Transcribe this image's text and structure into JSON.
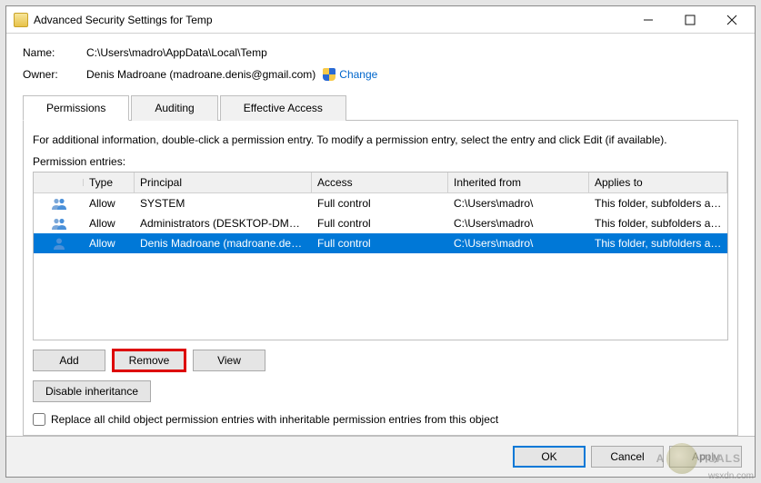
{
  "window": {
    "title": "Advanced Security Settings for Temp"
  },
  "header": {
    "name_label": "Name:",
    "name_value": "C:\\Users\\madro\\AppData\\Local\\Temp",
    "owner_label": "Owner:",
    "owner_value": "Denis Madroane (madroane.denis@gmail.com)",
    "change_link": "Change"
  },
  "tabs": {
    "permissions": "Permissions",
    "auditing": "Auditing",
    "effective": "Effective Access"
  },
  "info_text": "For additional information, double-click a permission entry. To modify a permission entry, select the entry and click Edit (if available).",
  "entries_label": "Permission entries:",
  "columns": {
    "type": "Type",
    "principal": "Principal",
    "access": "Access",
    "inherited": "Inherited from",
    "applies": "Applies to"
  },
  "rows": [
    {
      "type": "Allow",
      "principal": "SYSTEM",
      "access": "Full control",
      "inherited": "C:\\Users\\madro\\",
      "applies": "This folder, subfolders and files",
      "selected": false,
      "icon": "group"
    },
    {
      "type": "Allow",
      "principal": "Administrators (DESKTOP-DMO...",
      "access": "Full control",
      "inherited": "C:\\Users\\madro\\",
      "applies": "This folder, subfolders and files",
      "selected": false,
      "icon": "group"
    },
    {
      "type": "Allow",
      "principal": "Denis Madroane (madroane.deni...",
      "access": "Full control",
      "inherited": "C:\\Users\\madro\\",
      "applies": "This folder, subfolders and files",
      "selected": true,
      "icon": "user"
    }
  ],
  "buttons": {
    "add": "Add",
    "remove": "Remove",
    "view": "View",
    "disable_inh": "Disable inheritance",
    "ok": "OK",
    "cancel": "Cancel",
    "apply": "Apply"
  },
  "checkbox_label": "Replace all child object permission entries with inheritable permission entries from this object",
  "watermark": "A   PUALS",
  "attribution": "wsxdn.com"
}
